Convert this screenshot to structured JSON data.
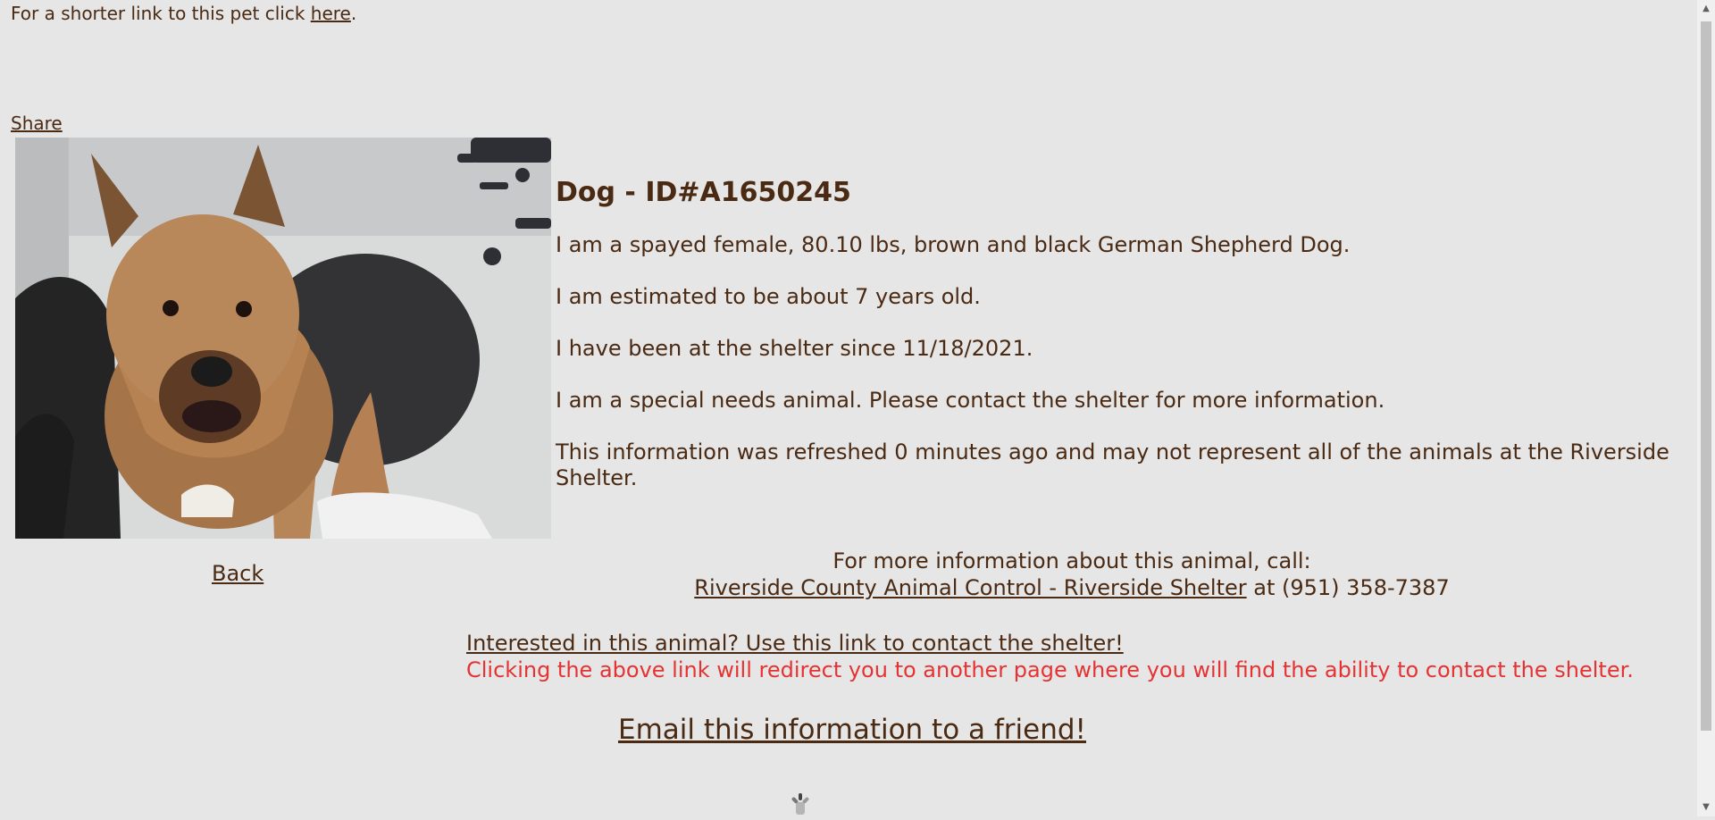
{
  "header": {
    "shortlink_prefix": "For a shorter link to this pet click ",
    "shortlink_link": "here",
    "shortlink_suffix": "."
  },
  "share_label": "Share",
  "pet": {
    "title": "Dog - ID#A1650245",
    "description": "I am a spayed female, 80.10 lbs, brown and black German Shepherd Dog.",
    "age": "I am estimated to be about 7 years old.",
    "since": "I have been at the shelter since 11/18/2021.",
    "special_needs": "I am a special needs animal. Please contact the shelter for more information.",
    "refresh_note": "This information was refreshed 0 minutes ago and may not represent all of the animals at the Riverside Shelter."
  },
  "back_label": "Back",
  "contact": {
    "prompt": "For more information about this animal, call:",
    "shelter_name": "Riverside County Animal Control - Riverside Shelter",
    "phone_text": " at (951) 358-7387"
  },
  "interested": {
    "link_text": "Interested in this animal? Use this link to contact the shelter!",
    "warning": "Clicking the above link will redirect you to another page where you will find the ability to contact the shelter."
  },
  "email_label": "Email this information to a friend!",
  "colors": {
    "background": "#e6e6e6",
    "text": "#4a2a12",
    "warning": "#e53333"
  }
}
